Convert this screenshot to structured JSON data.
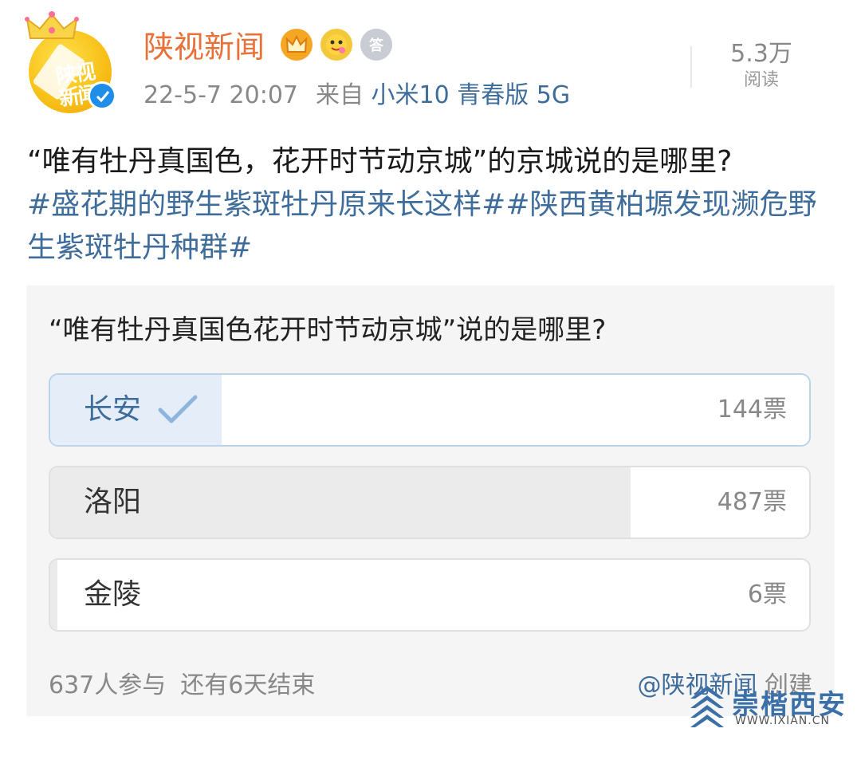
{
  "header": {
    "account_name": "陕视新闻",
    "avatar_text": "陕视新闻",
    "timestamp": "22-5-7 20:07",
    "source_prefix": "来自",
    "device": "小米10 青春版 5G",
    "reads_count": "5.3万",
    "reads_label": "阅读",
    "badges": [
      "vip-crown-badge",
      "emoji-badge",
      "medal-badge"
    ],
    "medal_badge_text": "答"
  },
  "post": {
    "text": "“唯有牡丹真国色，花开时节动京城”的京城说的是哪里?",
    "hashtags": "#盛花期的野生紫斑牡丹原来长这样##陕西黄柏塬发现濒危野生紫斑牡丹种群#"
  },
  "poll": {
    "question": "“唯有牡丹真国色花开时节动京城”说的是哪里?",
    "options": [
      {
        "label": "长安",
        "votes": "144票",
        "count": 144,
        "selected": true
      },
      {
        "label": "洛阳",
        "votes": "487票",
        "count": 487,
        "selected": false
      },
      {
        "label": "金陵",
        "votes": "6票",
        "count": 6,
        "selected": false
      }
    ],
    "participants": "637人参与",
    "remaining": "还有6天结束",
    "creator": "@陕视新闻",
    "creator_suffix": "创建"
  },
  "watermark": {
    "title": "崇楷西安",
    "url": "WWW.IXIAN.CN"
  },
  "colors": {
    "name_orange": "#e8713a",
    "link_blue": "#3f6d9b",
    "verified_blue": "#1e8ee8"
  }
}
